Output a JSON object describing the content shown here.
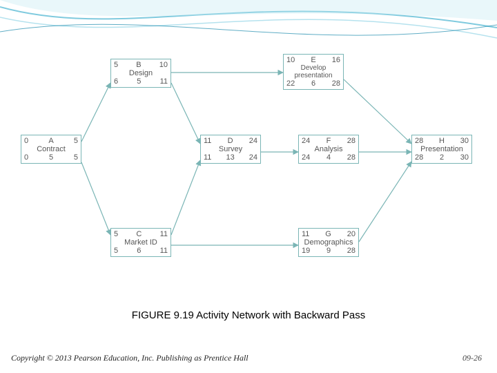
{
  "caption": "FIGURE 9.19  Activity Network with Backward Pass",
  "footer_left": "Copyright © 2013 Pearson Education, Inc. Publishing as Prentice Hall",
  "footer_right": "09-26",
  "chart_data": {
    "type": "table",
    "description": "Activity-on-node project network with forward (ES,EF) and backward (LS,LF) pass values and durations",
    "nodes": [
      {
        "id": "A",
        "name": "Contract",
        "ES": 0,
        "EF": 5,
        "LS": 0,
        "dur": 5,
        "LF": 5
      },
      {
        "id": "B",
        "name": "Design",
        "ES": 5,
        "EF": 10,
        "LS": 6,
        "dur": 5,
        "LF": 11
      },
      {
        "id": "C",
        "name": "Market ID",
        "ES": 5,
        "EF": 11,
        "LS": 5,
        "dur": 6,
        "LF": 11
      },
      {
        "id": "D",
        "name": "Survey",
        "ES": 11,
        "EF": 24,
        "LS": 11,
        "dur": 13,
        "LF": 24
      },
      {
        "id": "E",
        "name": "Develop presentation",
        "ES": 10,
        "EF": 16,
        "LS": 22,
        "dur": 6,
        "LF": 28
      },
      {
        "id": "F",
        "name": "Analysis",
        "ES": 24,
        "EF": 28,
        "LS": 24,
        "dur": 4,
        "LF": 28
      },
      {
        "id": "G",
        "name": "Demographics",
        "ES": 11,
        "EF": 20,
        "LS": 19,
        "dur": 9,
        "LF": 28
      },
      {
        "id": "H",
        "name": "Presentation",
        "ES": 28,
        "EF": 30,
        "LS": 28,
        "dur": 2,
        "LF": 30
      }
    ],
    "edges": [
      [
        "A",
        "B"
      ],
      [
        "A",
        "C"
      ],
      [
        "B",
        "D"
      ],
      [
        "B",
        "E"
      ],
      [
        "C",
        "D"
      ],
      [
        "C",
        "G"
      ],
      [
        "D",
        "F"
      ],
      [
        "E",
        "H"
      ],
      [
        "F",
        "H"
      ],
      [
        "G",
        "H"
      ]
    ]
  },
  "nodes": {
    "A": {
      "es": "0",
      "id": "A",
      "ef": "5",
      "name": "Contract",
      "ls": "0",
      "dur": "5",
      "lf": "5"
    },
    "B": {
      "es": "5",
      "id": "B",
      "ef": "10",
      "name": "Design",
      "ls": "6",
      "dur": "5",
      "lf": "11"
    },
    "C": {
      "es": "5",
      "id": "C",
      "ef": "11",
      "name": "Market ID",
      "ls": "5",
      "dur": "6",
      "lf": "11"
    },
    "D": {
      "es": "11",
      "id": "D",
      "ef": "24",
      "name": "Survey",
      "ls": "11",
      "dur": "13",
      "lf": "24"
    },
    "E": {
      "es": "10",
      "id": "E",
      "ef": "16",
      "name1": "Develop",
      "name2": "presentation",
      "ls": "22",
      "dur": "6",
      "lf": "28"
    },
    "F": {
      "es": "24",
      "id": "F",
      "ef": "28",
      "name": "Analysis",
      "ls": "24",
      "dur": "4",
      "lf": "28"
    },
    "G": {
      "es": "11",
      "id": "G",
      "ef": "20",
      "name": "Demographics",
      "ls": "19",
      "dur": "9",
      "lf": "28"
    },
    "H": {
      "es": "28",
      "id": "H",
      "ef": "30",
      "name": "Presentation",
      "ls": "28",
      "dur": "2",
      "lf": "30"
    }
  }
}
